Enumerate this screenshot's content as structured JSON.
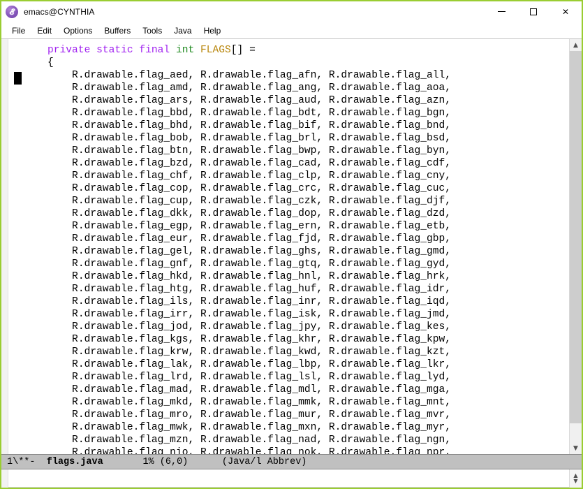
{
  "window": {
    "title": "emacs@CYNTHIA",
    "icon": "emacs-icon",
    "border_color": "#9ACD32",
    "controls": {
      "minimize_label": "Minimize",
      "maximize_label": "Maximize",
      "close_label": "✕"
    }
  },
  "menubar": {
    "items": [
      {
        "label": "File"
      },
      {
        "label": "Edit"
      },
      {
        "label": "Options"
      },
      {
        "label": "Buffers"
      },
      {
        "label": "Tools"
      },
      {
        "label": "Java"
      },
      {
        "label": "Help"
      }
    ]
  },
  "editor": {
    "syntax_colors": {
      "keyword": "#a020f0",
      "type": "#228b22",
      "variable": "#b8860b",
      "plain": "#000000",
      "background": "#ffffff"
    },
    "declaration": {
      "keywords": "private static final",
      "type": "int",
      "name": "FLAGS",
      "suffix": "[] ="
    },
    "open_brace": "{",
    "indent": "        ",
    "entry_prefix": "R.drawable.flag_",
    "rows": [
      [
        "aed",
        "afn",
        "all"
      ],
      [
        "amd",
        "ang",
        "aoa"
      ],
      [
        "ars",
        "aud",
        "azn"
      ],
      [
        "bbd",
        "bdt",
        "bgn"
      ],
      [
        "bhd",
        "bif",
        "bnd"
      ],
      [
        "bob",
        "brl",
        "bsd"
      ],
      [
        "btn",
        "bwp",
        "byn"
      ],
      [
        "bzd",
        "cad",
        "cdf"
      ],
      [
        "chf",
        "clp",
        "cny"
      ],
      [
        "cop",
        "crc",
        "cuc"
      ],
      [
        "cup",
        "czk",
        "djf"
      ],
      [
        "dkk",
        "dop",
        "dzd"
      ],
      [
        "egp",
        "ern",
        "etb"
      ],
      [
        "eur",
        "fjd",
        "gbp"
      ],
      [
        "gel",
        "ghs",
        "gmd"
      ],
      [
        "gnf",
        "gtq",
        "gyd"
      ],
      [
        "hkd",
        "hnl",
        "hrk"
      ],
      [
        "htg",
        "huf",
        "idr"
      ],
      [
        "ils",
        "inr",
        "iqd"
      ],
      [
        "irr",
        "isk",
        "jmd"
      ],
      [
        "jod",
        "jpy",
        "kes"
      ],
      [
        "kgs",
        "khr",
        "kpw"
      ],
      [
        "krw",
        "kwd",
        "kzt"
      ],
      [
        "lak",
        "lbp",
        "lkr"
      ],
      [
        "lrd",
        "lsl",
        "lyd"
      ],
      [
        "mad",
        "mdl",
        "mga"
      ],
      [
        "mkd",
        "mmk",
        "mnt"
      ],
      [
        "mro",
        "mur",
        "mvr"
      ],
      [
        "mwk",
        "mxn",
        "myr"
      ],
      [
        "mzn",
        "nad",
        "ngn"
      ],
      [
        "nio",
        "nok",
        "npr"
      ]
    ]
  },
  "modeline": {
    "coding_indicator": "1\\**-",
    "buffer_name": "flags.java",
    "percent": "1%",
    "position": "(6,0)",
    "major_mode": "(Java/l Abbrev)"
  },
  "minibuffer": {
    "text": ""
  },
  "scrollbar": {
    "up_arrow": "▲",
    "down_arrow": "▼"
  }
}
